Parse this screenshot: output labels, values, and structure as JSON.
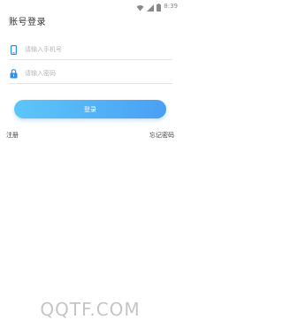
{
  "status_bar": {
    "time": "8:39",
    "icons": [
      "wifi-icon",
      "signal-icon",
      "battery-icon"
    ]
  },
  "header": {
    "title": "账号登录"
  },
  "form": {
    "phone_placeholder": "请输入手机号",
    "password_placeholder": "请输入密码",
    "login_label": "登录"
  },
  "links": {
    "register": "注册",
    "forgot_password": "忘记密码"
  },
  "watermark": "QQTF.COM",
  "colors": {
    "accent": "#4aa0f4",
    "accent_start": "#5cc6f8",
    "icon_blue": "#2f8df0"
  }
}
